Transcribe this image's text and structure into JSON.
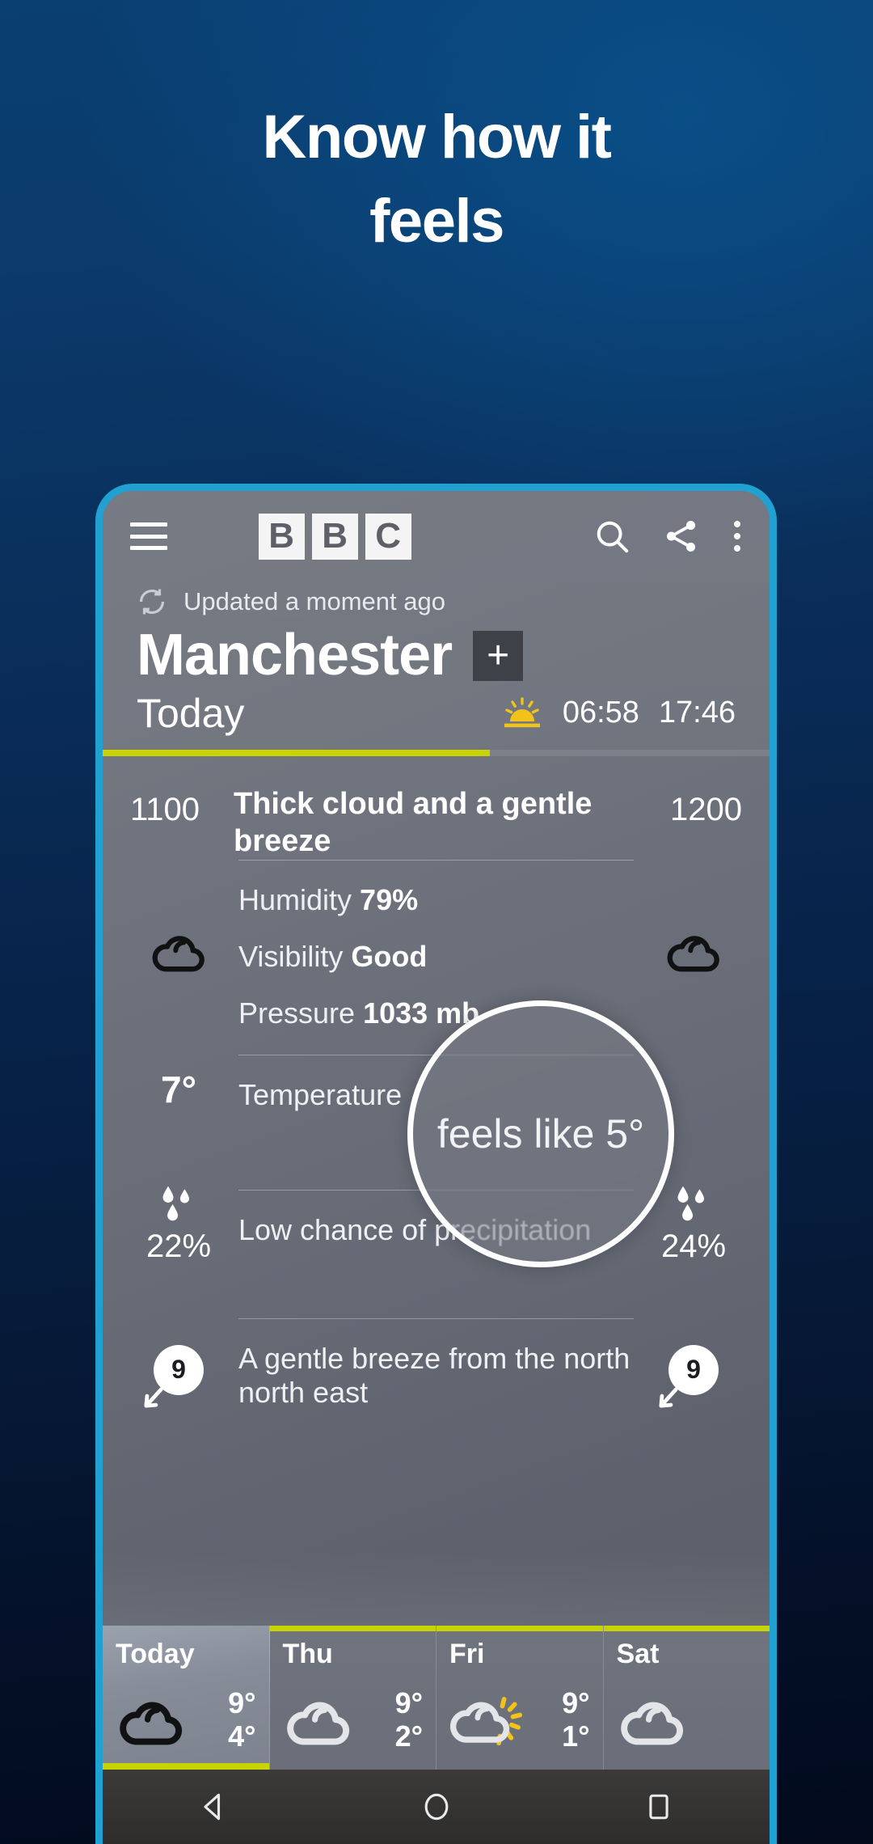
{
  "promo": {
    "line1": "Know how it",
    "line2": "feels"
  },
  "appbar": {
    "menu_icon": "hamburger-menu-icon",
    "logo_letters": [
      "B",
      "B",
      "C"
    ],
    "search_icon": "search-icon",
    "share_icon": "share-icon",
    "overflow_icon": "more-vertical-icon"
  },
  "status": {
    "refresh_icon": "refresh-icon",
    "updated_text": "Updated a moment ago"
  },
  "location": {
    "name": "Manchester",
    "add_label": "+"
  },
  "today": {
    "label": "Today",
    "sun_icon": "sunrise-icon",
    "sunrise": "06:58",
    "sunset": "17:46"
  },
  "hour": {
    "left_time": "1100",
    "right_time": "1200",
    "description": "Thick cloud and a gentle breeze"
  },
  "details": [
    {
      "label": "Humidity",
      "value": "79%"
    },
    {
      "label": "Visibility",
      "value": "Good"
    },
    {
      "label": "Pressure",
      "value": "1033 mb"
    },
    {
      "label": "Temperature",
      "value": ""
    }
  ],
  "temperature": {
    "left": "7°",
    "right": ""
  },
  "magnifier": {
    "text": "feels like 5°"
  },
  "precipitation": {
    "text": "Low chance of precipitation",
    "left_pct": "22%",
    "right_pct": "24%",
    "icon": "raindrops-icon"
  },
  "wind": {
    "text": "A gentle breeze from the north north east",
    "left_speed": "9",
    "right_speed": "9",
    "icon": "wind-direction-arrow-icon"
  },
  "days": [
    {
      "name": "Today",
      "icon": "cloud-icon",
      "high": "9°",
      "low": "4°",
      "active": true
    },
    {
      "name": "Thu",
      "icon": "cloud-icon",
      "high": "9°",
      "low": "2°",
      "active": false
    },
    {
      "name": "Fri",
      "icon": "sun-cloud-icon",
      "high": "9°",
      "low": "1°",
      "active": false
    },
    {
      "name": "Sat",
      "icon": "cloud-icon",
      "high": "",
      "low": "",
      "active": false
    }
  ],
  "navbar": {
    "back_icon": "back-triangle-icon",
    "home_icon": "home-circle-icon",
    "recents_icon": "recents-square-icon"
  },
  "colors": {
    "accent_yellow": "#c8d400",
    "frame_blue": "#21a0d2",
    "bg_deep_blue": "#0a3f72"
  }
}
